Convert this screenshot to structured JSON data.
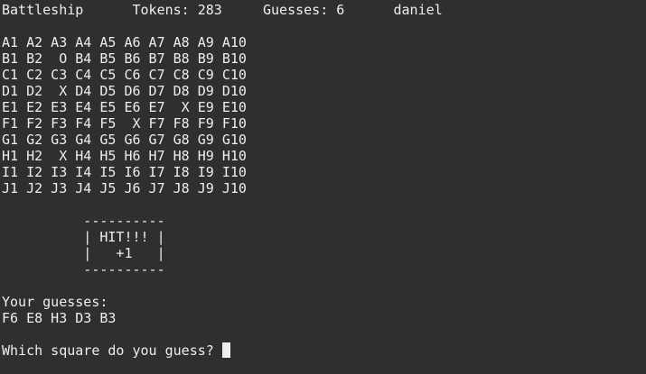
{
  "header": {
    "line": "Battleship      Tokens: 283     Guesses: 6      daniel"
  },
  "board": {
    "rows": [
      "A1 A2 A3 A4 A5 A6 A7 A8 A9 A10",
      "B1 B2  O B4 B5 B6 B7 B8 B9 B10",
      "C1 C2 C3 C4 C5 C6 C7 C8 C9 C10",
      "D1 D2  X D4 D5 D6 D7 D8 D9 D10",
      "E1 E2 E3 E4 E5 E6 E7  X E9 E10",
      "F1 F2 F3 F4 F5  X F7 F8 F9 F10",
      "G1 G2 G3 G4 G5 G6 G7 G8 G9 G10",
      "H1 H2  X H4 H5 H6 H7 H8 H9 H10",
      "I1 I2 I3 I4 I5 I6 I7 I8 I9 I10",
      "J1 J2 J3 J4 J5 J6 J7 J8 J9 J10"
    ]
  },
  "hit_box": {
    "top": "          ----------",
    "hit": "          | HIT!!! |",
    "points": "          |   +1   |",
    "bottom": "          ----------"
  },
  "guesses": {
    "label": "Your guesses:",
    "list": "F6 E8 H3 D3 B3"
  },
  "prompt": {
    "text": "Which square do you guess? "
  }
}
